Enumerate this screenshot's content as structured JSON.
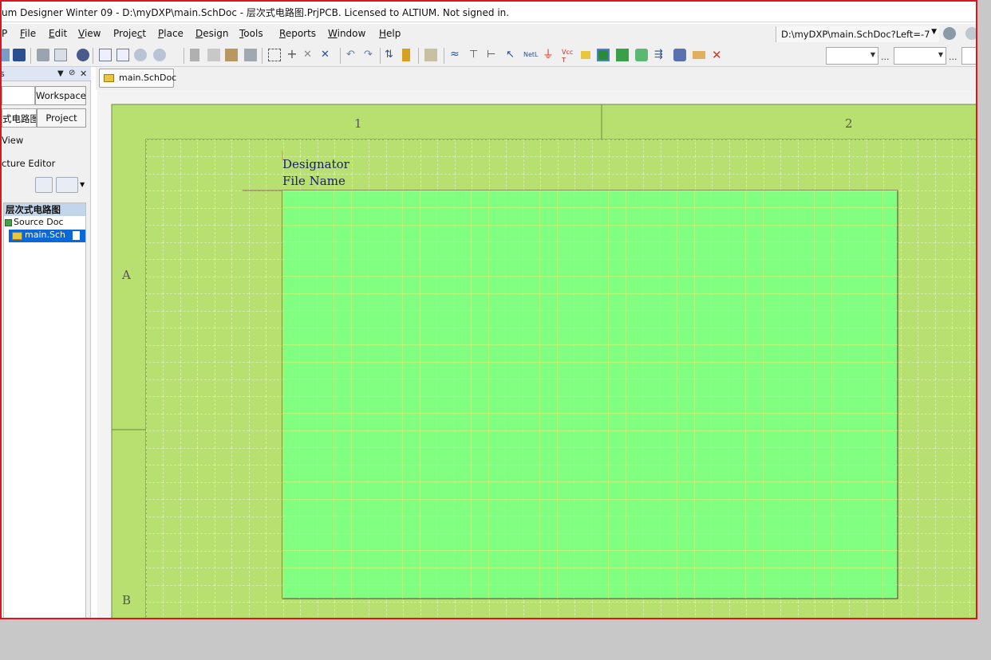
{
  "window": {
    "title": "um Designer Winter 09 - D:\\myDXP\\main.SchDoc - 层次式电路图.PrjPCB. Licensed to ALTIUM. Not signed in."
  },
  "menu": [
    {
      "label": "P",
      "hotkey": ""
    },
    {
      "label": "File",
      "hotkey": "F"
    },
    {
      "label": "Edit",
      "hotkey": "E"
    },
    {
      "label": "View",
      "hotkey": "V"
    },
    {
      "label": "Project",
      "hotkey": "c"
    },
    {
      "label": "Place",
      "hotkey": "P"
    },
    {
      "label": "Design",
      "hotkey": "D"
    },
    {
      "label": "Tools",
      "hotkey": "T"
    },
    {
      "label": "Reports",
      "hotkey": "R"
    },
    {
      "label": "Window",
      "hotkey": "W"
    },
    {
      "label": "Help",
      "hotkey": "H"
    }
  ],
  "address": {
    "value": "D:\\myDXP\\main.SchDoc?Left=-7"
  },
  "toolbar_icons": [
    "save-icon",
    "print-icon",
    "print-preview-icon",
    "3d-view-icon",
    "zoom-fit-icon",
    "zoom-area-icon",
    "zoom-selected-icon",
    "zoom-filter-icon",
    "cut-icon",
    "copy-icon",
    "paste-icon",
    "rubber-stamp-icon",
    "select-area-icon",
    "move-icon",
    "deselect-icon",
    "clear-filter-icon",
    "undo-icon",
    "redo-icon",
    "hierarchy-icon",
    "cross-probe-icon",
    "browse-library-icon",
    "wire-icon",
    "bus-icon",
    "bus-entry-icon",
    "net-label-icon",
    "ground-power-icon",
    "vcc-power-icon",
    "part-icon",
    "sheet-symbol-icon",
    "sheet-entry-icon",
    "port-icon",
    "device-sheet-icon",
    "harness-icon",
    "no-erc-icon",
    "delete-icon"
  ],
  "left_panel": {
    "workspace_button": "Workspace",
    "project_name": "式电路图",
    "project_button": "Project",
    "view_label": "View",
    "structure_editor_label": "cture Editor",
    "tree": {
      "project": "层次式电路图",
      "source_docs": "Source Doc",
      "main_doc": "main.Sch"
    }
  },
  "doc_tab": {
    "label": "main.SchDoc"
  },
  "sheet": {
    "zone_columns": [
      "1",
      "2"
    ],
    "zone_rows": [
      "A",
      "B"
    ],
    "symbol": {
      "designator": "Designator",
      "file_name": "File Name"
    },
    "colors": {
      "border": "#b8e070",
      "sheet_fill": "#b8e070",
      "symbol_fill": "#80ff80",
      "grid_line": "#ffffff",
      "symbol_grid": "#f2f070",
      "label": "#1a1a6e"
    }
  }
}
